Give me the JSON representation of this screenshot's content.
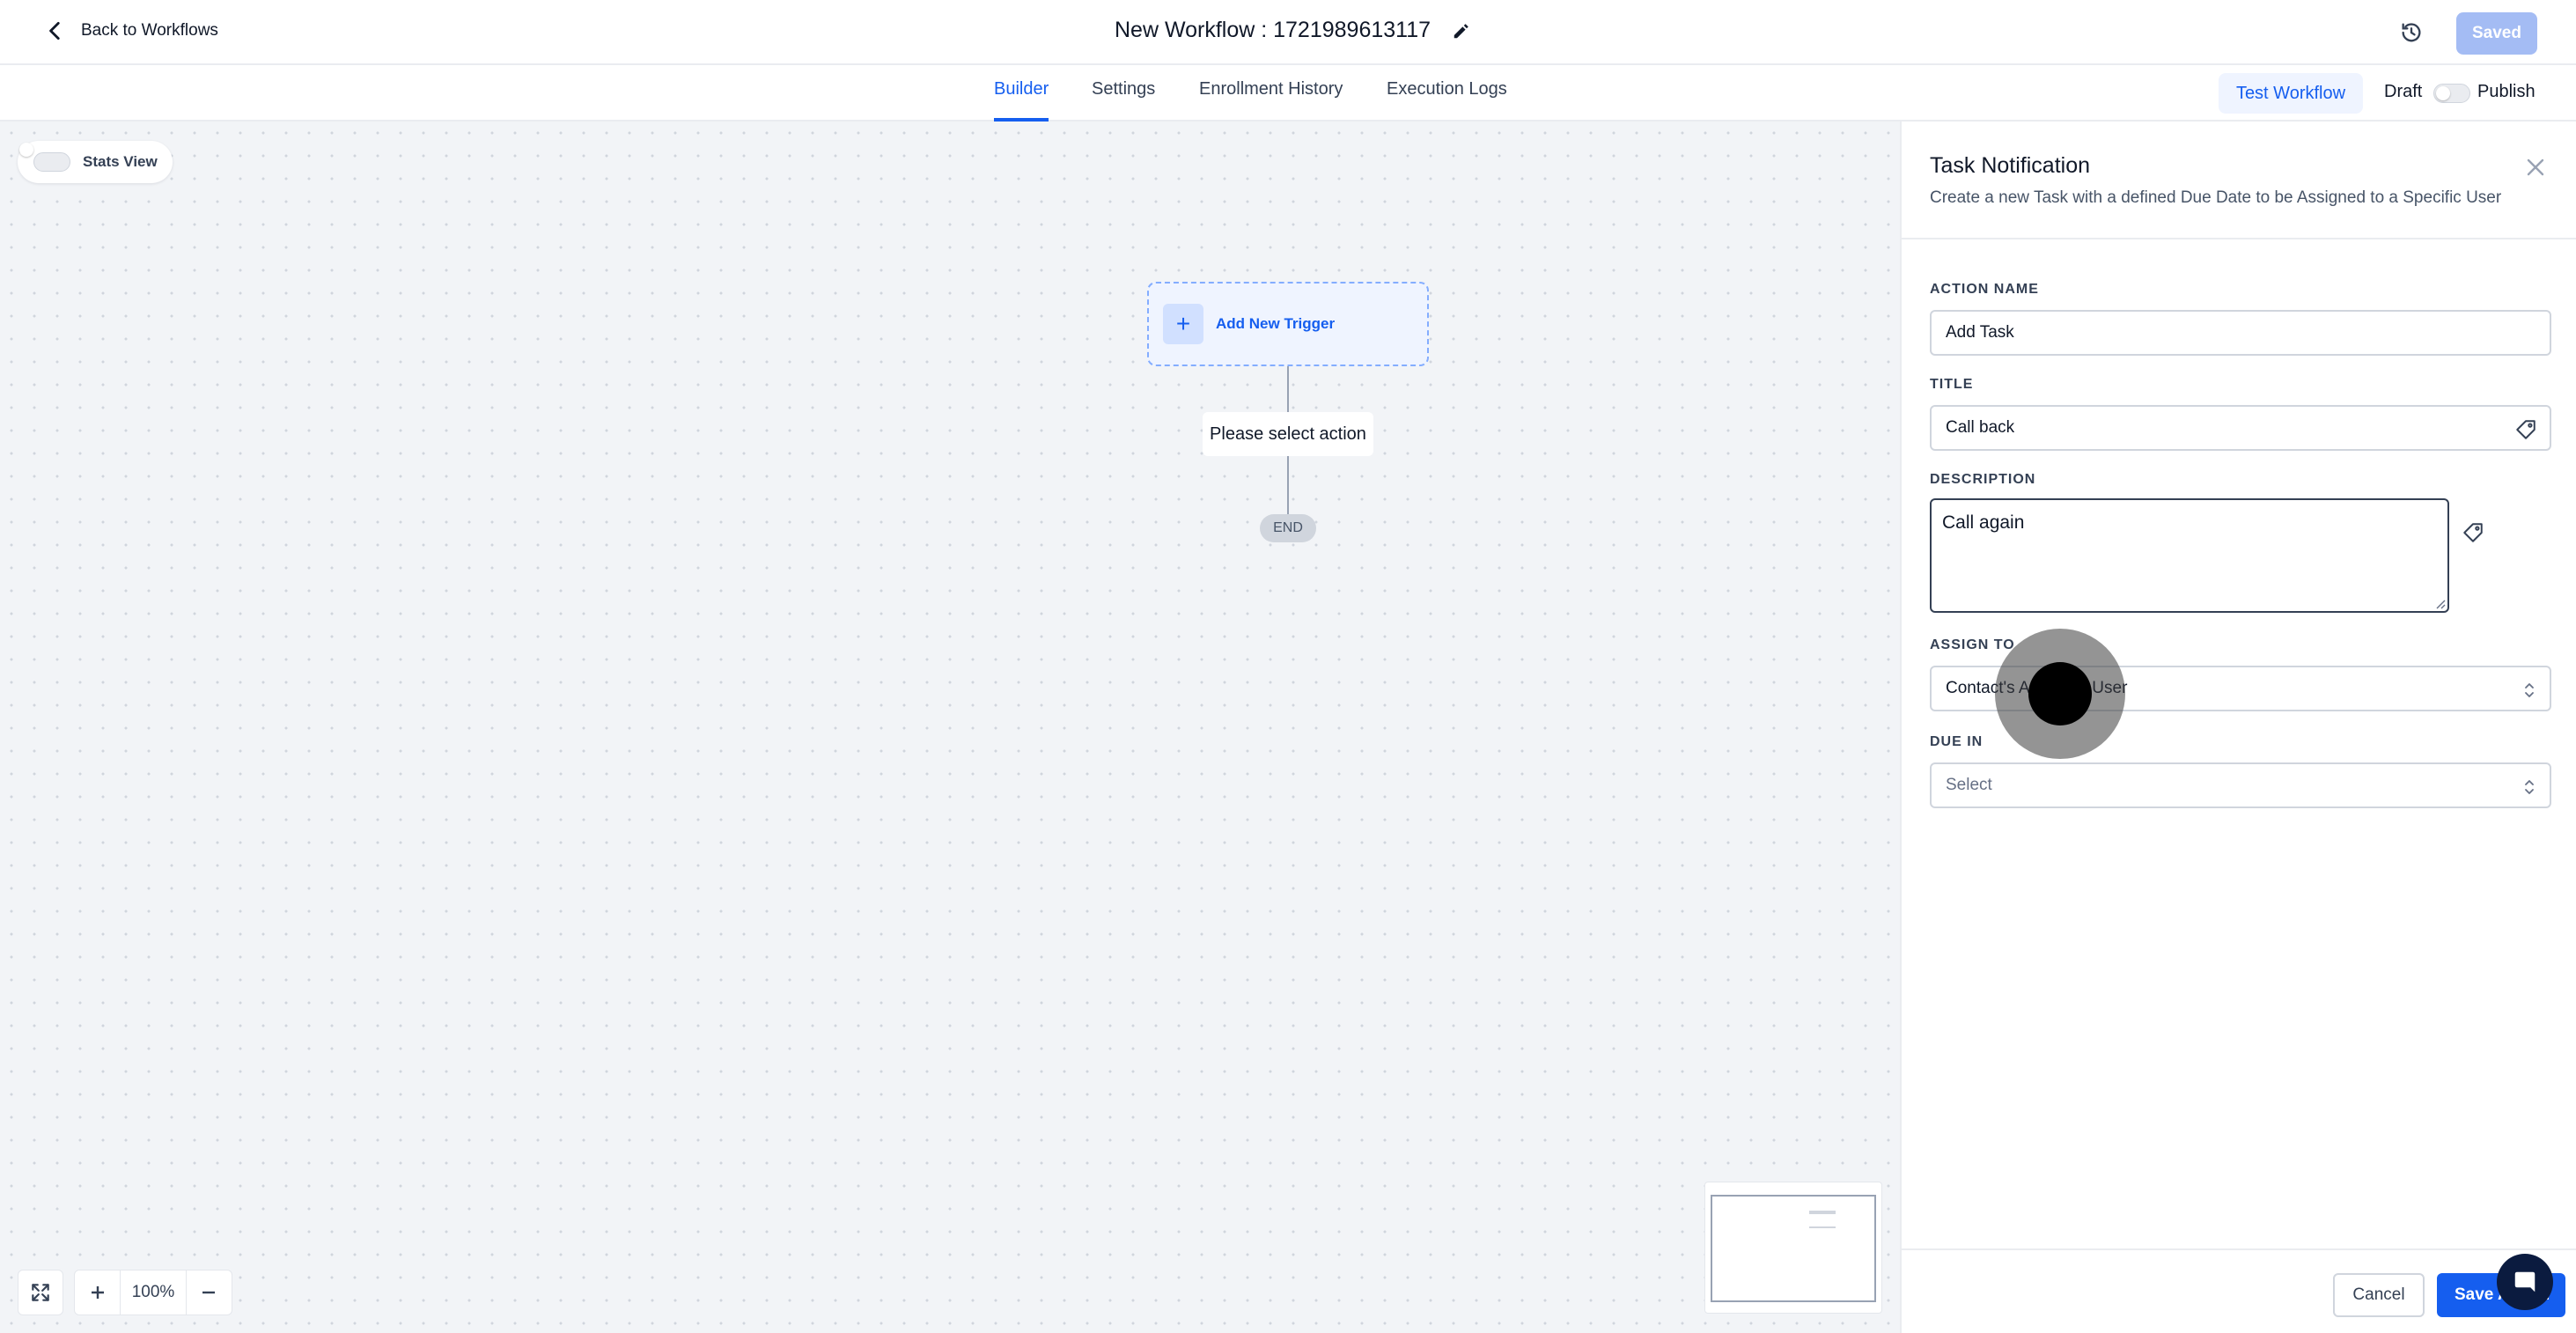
{
  "header": {
    "back_label": "Back to Workflows",
    "workflow_title": "New Workflow : 1721989613117",
    "saved_label": "Saved"
  },
  "tabs": [
    {
      "label": "Builder",
      "active": true
    },
    {
      "label": "Settings",
      "active": false
    },
    {
      "label": "Enrollment History",
      "active": false
    },
    {
      "label": "Execution Logs",
      "active": false
    }
  ],
  "toolbar": {
    "test_label": "Test Workflow",
    "draft_label": "Draft",
    "publish_label": "Publish",
    "publish_toggle_on": false
  },
  "canvas": {
    "stats_label": "Stats View",
    "stats_toggle_on": false,
    "trigger_label": "Add New Trigger",
    "action_label": "Please select action",
    "end_label": "END",
    "zoom_label": "100%"
  },
  "panel": {
    "title": "Task Notification",
    "subtitle": "Create a new Task with a defined Due Date to be Assigned to a Specific User",
    "fields": {
      "action_name": {
        "label": "ACTION NAME",
        "value": "Add Task"
      },
      "title": {
        "label": "TITLE",
        "value": "Call back"
      },
      "description": {
        "label": "DESCRIPTION",
        "value": "Call again"
      },
      "assign_to": {
        "label": "ASSIGN TO",
        "value": "Contact's Assigned User"
      },
      "due_in": {
        "label": "DUE IN",
        "placeholder": "Select"
      }
    },
    "cancel_label": "Cancel",
    "save_label": "Save Action"
  },
  "colors": {
    "accent": "#155eef",
    "saved_button": "#a4bcf4",
    "canvas_bg": "#f2f4f7",
    "chat_bubble": "#0b1b3f"
  },
  "icons": [
    "chevron-left-icon",
    "pencil-icon",
    "history-icon",
    "plus-icon",
    "close-icon",
    "tag-icon",
    "sort-icon",
    "fit-view-icon",
    "minus-icon",
    "chat-icon"
  ]
}
